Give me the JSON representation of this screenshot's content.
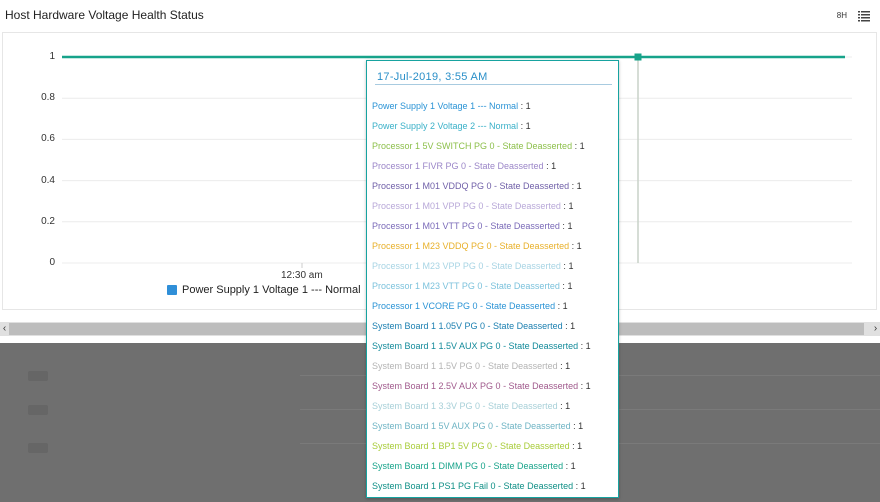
{
  "panel": {
    "title": "Host Hardware Voltage Health Status",
    "time_range": "8H",
    "menu_icon": "list-icon"
  },
  "chart_data": {
    "type": "line",
    "title": "",
    "yticks": [
      "1",
      "0.8",
      "0.6",
      "0.4",
      "0.2",
      "0"
    ],
    "ylim": [
      0,
      1
    ],
    "x_tick_labels": [
      "12:30 am"
    ],
    "grid": true,
    "series": [
      {
        "name": "Power Supply 1 Voltage 1 --- Normal",
        "color": "#17a38a",
        "values": [
          1,
          1
        ]
      }
    ],
    "legend_position": "bottom-left"
  },
  "legend": {
    "label": "Power Supply 1 Voltage 1 --- Normal",
    "color": "#2f8fd8"
  },
  "scrollbar": {
    "left_arrow": "‹",
    "right_arrow": "›"
  },
  "tooltip": {
    "date": "17-Jul-2019, 3:55 AM",
    "rows": [
      {
        "label": "Power Supply 1 Voltage 1 --- Normal",
        "sep": " : ",
        "value": "1",
        "color": "#2a93d5"
      },
      {
        "label": "Power Supply 2 Voltage 2 --- Normal",
        "sep": " : ",
        "value": "1",
        "color": "#3ab0c8"
      },
      {
        "label": "Processor 1 5V SWITCH PG 0 - State Deasserted",
        "sep": " : ",
        "value": "1",
        "color": "#8cbf4a"
      },
      {
        "label": "Processor 1 FIVR PG 0 - State Deasserted",
        "sep": " : ",
        "value": "1",
        "color": "#9b86c8"
      },
      {
        "label": "Processor 1 M01 VDDQ PG 0 - State Deasserted",
        "sep": " : ",
        "value": "1",
        "color": "#7060a8"
      },
      {
        "label": "Processor 1 M01 VPP PG 0 - State Deasserted",
        "sep": " : ",
        "value": "1",
        "color": "#b8a8d8"
      },
      {
        "label": "Processor 1 M01 VTT PG 0 - State Deasserted",
        "sep": " : ",
        "value": "1",
        "color": "#7a6ab8"
      },
      {
        "label": "Processor 1 M23 VDDQ PG 0 - State Deasserted",
        "sep": " : ",
        "value": "1",
        "color": "#e8b02a"
      },
      {
        "label": "Processor 1 M23 VPP PG 0 - State Deasserted",
        "sep": " : ",
        "value": "1",
        "color": "#a8d4e4"
      },
      {
        "label": "Processor 1 M23 VTT PG 0 - State Deasserted",
        "sep": " : ",
        "value": "1",
        "color": "#7cc2dc"
      },
      {
        "label": "Processor 1 VCORE PG 0 - State Deasserted",
        "sep": " : ",
        "value": "1",
        "color": "#2a93d5"
      },
      {
        "label": "System Board 1 1.05V PG 0 - State Deasserted",
        "sep": " : ",
        "value": "1",
        "color": "#1b7fb0"
      },
      {
        "label": "System Board 1 1.5V AUX PG 0 - State Deasserted",
        "sep": " : ",
        "value": "1",
        "color": "#138a9a"
      },
      {
        "label": "System Board 1 1.5V PG 0 - State Deasserted",
        "sep": " : ",
        "value": "1",
        "color": "#b4b4b4"
      },
      {
        "label": "System Board 1 2.5V AUX PG 0 - State Deasserted",
        "sep": " : ",
        "value": "1",
        "color": "#a05a8c"
      },
      {
        "label": "System Board 1 3.3V PG 0 - State Deasserted",
        "sep": " : ",
        "value": "1",
        "color": "#a8d0d8"
      },
      {
        "label": "System Board 1 5V AUX PG 0 - State Deasserted",
        "sep": " : ",
        "value": "1",
        "color": "#6fb4c4"
      },
      {
        "label": "System Board 1 BP1 5V PG 0 - State Deasserted",
        "sep": " : ",
        "value": "1",
        "color": "#a8cc3a"
      },
      {
        "label": "System Board 1 DIMM PG 0 - State Deasserted",
        "sep": " : ",
        "value": "1",
        "color": "#17a38a"
      },
      {
        "label": "System Board 1 PS1 PG Fail 0 - State Deasserted",
        "sep": " : ",
        "value": "1",
        "color": "#0f8f86"
      }
    ]
  }
}
